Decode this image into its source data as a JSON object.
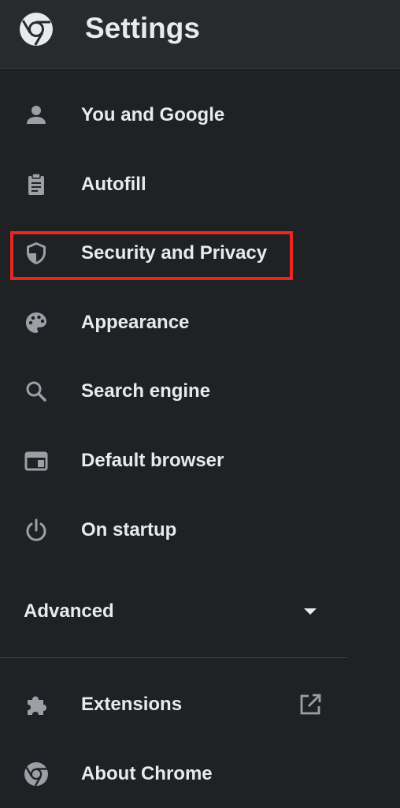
{
  "header": {
    "title": "Settings",
    "logo_icon": "chrome-logo-icon"
  },
  "nav": {
    "items": [
      {
        "label": "You and Google",
        "icon": "person-icon"
      },
      {
        "label": "Autofill",
        "icon": "clipboard-icon"
      },
      {
        "label": "Security and Privacy",
        "icon": "shield-icon",
        "highlighted": true
      },
      {
        "label": "Appearance",
        "icon": "palette-icon"
      },
      {
        "label": "Search engine",
        "icon": "search-icon"
      },
      {
        "label": "Default browser",
        "icon": "browser-window-icon"
      },
      {
        "label": "On startup",
        "icon": "power-icon"
      }
    ],
    "advanced": {
      "label": "Advanced",
      "icon": "caret-down-icon"
    },
    "bottom_items": [
      {
        "label": "Extensions",
        "icon": "puzzle-icon",
        "trailing_icon": "open-in-new-icon"
      },
      {
        "label": "About Chrome",
        "icon": "chrome-logo-icon"
      }
    ]
  },
  "colors": {
    "background": "#202124",
    "header_background": "#292a2d",
    "text": "#e8eaed",
    "icon": "#9aa0a6",
    "highlight_border": "#e8281f"
  }
}
